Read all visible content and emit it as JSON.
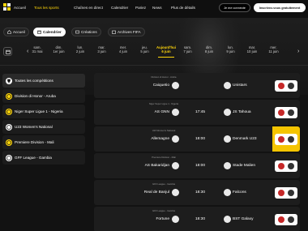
{
  "nav": {
    "items": [
      "Accueil",
      "Tous les sports",
      "Chaînes en direct",
      "Calendrier",
      "Pariez",
      "News",
      "Plus de détails"
    ],
    "active_index": 1,
    "login": "Je me connecte",
    "register": "Inscrivez-vous gratuitement"
  },
  "tabs": [
    "Accueil",
    "Calendrier",
    "Créations",
    "Archives FIFA"
  ],
  "active_tab": 1,
  "dates": [
    {
      "day": "sam.",
      "date": "31 mai"
    },
    {
      "day": "dim.",
      "date": "1er juin"
    },
    {
      "day": "lun.",
      "date": "2 juin"
    },
    {
      "day": "mar.",
      "date": "3 juin"
    },
    {
      "day": "mer.",
      "date": "4 juin"
    },
    {
      "day": "jeu.",
      "date": "5 juin"
    },
    {
      "day": "Aujourd'hui",
      "date": "6 juin"
    },
    {
      "day": "sam.",
      "date": "7 juin"
    },
    {
      "day": "dim.",
      "date": "8 juin"
    },
    {
      "day": "lun.",
      "date": "9 juin"
    },
    {
      "day": "mar.",
      "date": "10 juin"
    },
    {
      "day": "mer.",
      "date": "11 juin"
    }
  ],
  "active_date": 6,
  "competitions": [
    {
      "label": "Toutes les compétitions",
      "icon": "trophy-icon"
    },
    {
      "label": "Division di Honor - Aruba",
      "icon": "soccer-ball-icon"
    },
    {
      "label": "Niger Super Ligue 1 - Nigeria",
      "icon": "soccer-ball-icon"
    },
    {
      "label": "U23 Women's National",
      "icon": "soccer-ball-icon"
    },
    {
      "label": "Premiere Division - Mali",
      "icon": "soccer-ball-icon"
    },
    {
      "label": "GFF League - Gambia",
      "icon": "soccer-ball-icon"
    }
  ],
  "matches": [
    {
      "league": "Division di Honor - Aruba",
      "home": "Caiquetio",
      "time": "",
      "away": "Unistars",
      "promo_color": "#ffffff"
    },
    {
      "league": "Niger Super Ligue 1 - Nigeria",
      "home": "AS GNN",
      "time": "17:45",
      "away": "JS Tahoua",
      "promo_color": "#ffffff"
    },
    {
      "league": "U23 Women's National",
      "home": "Allemagne",
      "time": "18:00",
      "away": "Denmark U23",
      "promo_color": "#f5c400"
    },
    {
      "league": "Premiere Division - Mali",
      "home": "AS Bakaridjan",
      "time": "18:00",
      "away": "Stade Malien",
      "promo_color": "#ffffff"
    },
    {
      "league": "GFF League - Gambia",
      "home": "Real de Banjul",
      "time": "18:30",
      "away": "Falcons",
      "promo_color": "#ffffff"
    },
    {
      "league": "GFF League - Gambia",
      "home": "Fortune",
      "time": "18:30",
      "away": "BST Galaxy",
      "promo_color": "#ffffff"
    }
  ],
  "colors": {
    "accent": "#ffd60a",
    "background": "#121212",
    "card": "#1d1d1d"
  }
}
